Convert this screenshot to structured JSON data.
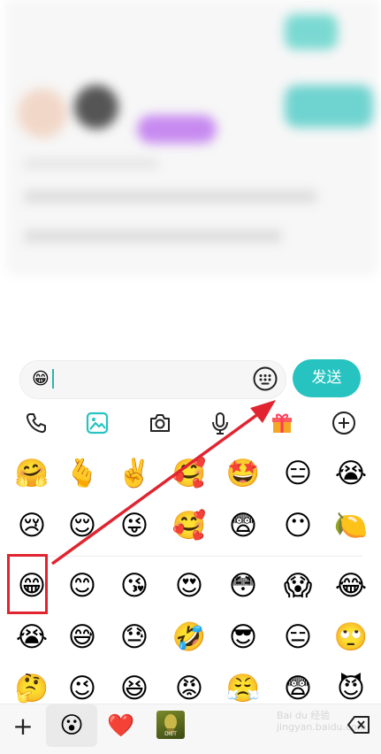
{
  "input": {
    "content": "😁"
  },
  "send_label": "发送",
  "colors": {
    "accent": "#27c3c0",
    "highlight": "#e02430",
    "arrow": "#e02430"
  },
  "toolbar": [
    {
      "icon": "phone-icon"
    },
    {
      "icon": "image-icon"
    },
    {
      "icon": "camera-icon"
    },
    {
      "icon": "voice-icon"
    },
    {
      "icon": "gift-icon"
    },
    {
      "icon": "add-circle-icon"
    }
  ],
  "emoji_rows": [
    [
      "🤗",
      "🫰",
      "✌️",
      "🥰",
      "🤩",
      "😑",
      "😭"
    ],
    [
      "😢",
      "😌",
      "😜",
      "🥰",
      "😨",
      "😶",
      "🍋"
    ],
    [
      "😁",
      "😊",
      "😘",
      "😍",
      "😳",
      "😱",
      "😂"
    ],
    [
      "😭",
      "😅",
      "😓",
      "🤣",
      "😎",
      "😑",
      "🙄"
    ],
    [
      "🤔",
      "😉",
      "😆",
      "😡",
      "😤",
      "😨",
      "😈"
    ]
  ],
  "bottom_tabs": [
    {
      "icon": "plus-icon",
      "label": "+"
    },
    {
      "icon": "smiley-icon",
      "label": "😮"
    },
    {
      "icon": "heart-icon",
      "label": "❤️"
    },
    {
      "icon": "sticker-thumbnail",
      "label": "DIET"
    }
  ],
  "watermark": "Bai du 经验\njingyan.baidu.com"
}
